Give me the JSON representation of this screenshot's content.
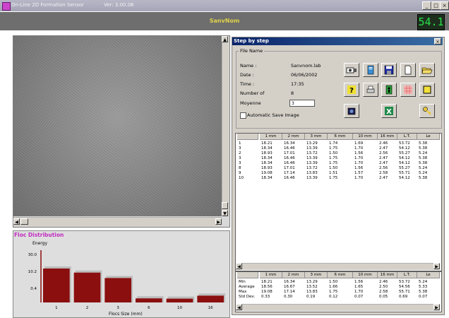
{
  "window": {
    "title": "On-Line 2D Formation Sensor",
    "version": "Ver: 3.00.06",
    "buttons": [
      "_",
      "□",
      "×"
    ]
  },
  "header": {
    "sample_name": "SanvNom",
    "readout": "54.1"
  },
  "floc_distribution": {
    "title": "Floc Distribution"
  },
  "chart_data": {
    "type": "bar",
    "title": "",
    "ylabel": "Energy",
    "xlabel": "Flocs Size (mm)",
    "categories": [
      "1",
      "2",
      "3",
      "6",
      "10",
      "16"
    ],
    "values": [
      12.5,
      11.0,
      9.0,
      1.5,
      1.4,
      2.5
    ],
    "ytick_labels": [
      "30.0",
      "10.2",
      "0.4"
    ],
    "yticks": [
      30.0,
      10.2,
      0.4
    ],
    "ylim": [
      0,
      30.0
    ],
    "bar_color": "#8b0f0f",
    "background_bar_color": "#bcbcbc",
    "grid": false
  },
  "dialog": {
    "title": "Step by step",
    "close_label": "×",
    "file_name_legend": "File Name",
    "fields": [
      {
        "label": "Name :",
        "value": "Sanvnom.lab"
      },
      {
        "label": "Date :",
        "value": "06/06/2002"
      },
      {
        "label": "Time :",
        "value": "17:35"
      },
      {
        "label": "Number of",
        "value": "8"
      },
      {
        "label": "Moyenne",
        "value": ""
      }
    ],
    "moyenne_input_value": "3",
    "auto_save_label": "Automatic Save Image",
    "toolbar_icons": [
      "camera-film-icon",
      "notepad-icon",
      "save-disk-icon",
      "new-page-icon",
      "open-folder-icon",
      "help-icon",
      "print-icon",
      "exit-door-icon",
      "color-grid-icon",
      "yellow-square-icon",
      "photo-camera-icon",
      "excel-icon",
      "key-icon"
    ]
  },
  "results_table": {
    "columns": [
      "",
      "1 mm",
      "2 mm",
      "3 mm",
      "6 mm",
      "10 mm",
      "16 mm",
      "L.T.",
      "Le"
    ],
    "rows": [
      [
        "1",
        "18.21",
        "16.34",
        "13.29",
        "1.74",
        "1.69",
        "2.46",
        "53.72",
        "5.38"
      ],
      [
        "3",
        "18.34",
        "16.46",
        "13.39",
        "1.75",
        "1.70",
        "2.47",
        "54.12",
        "5.38"
      ],
      [
        "2",
        "18.93",
        "17.01",
        "13.72",
        "1.50",
        "1.56",
        "2.56",
        "55.27",
        "5.24"
      ],
      [
        "3",
        "18.34",
        "16.46",
        "13.39",
        "1.75",
        "1.70",
        "2.47",
        "54.12",
        "5.38"
      ],
      [
        "3",
        "18.34",
        "16.46",
        "13.39",
        "1.75",
        "1.70",
        "2.47",
        "54.12",
        "5.38"
      ],
      [
        "8",
        "18.93",
        "17.01",
        "13.72",
        "1.50",
        "1.56",
        "2.56",
        "55.27",
        "5.24"
      ],
      [
        "9",
        "19.08",
        "17.14",
        "13.83",
        "1.51",
        "1.57",
        "2.58",
        "55.71",
        "5.24"
      ],
      [
        "10",
        "18.34",
        "16.46",
        "13.39",
        "1.75",
        "1.70",
        "2.47",
        "54.12",
        "5.38"
      ]
    ]
  },
  "stats_table": {
    "columns": [
      "",
      "1 mm",
      "2 mm",
      "3 mm",
      "6 mm",
      "10 mm",
      "16 mm",
      "L.T.",
      "Le"
    ],
    "rows": [
      [
        "Min",
        "18.21",
        "16.34",
        "13.29",
        "1.50",
        "1.56",
        "2.46",
        "53.72",
        "5.24"
      ],
      [
        "Average",
        "18.56",
        "16.67",
        "13.52",
        "1.66",
        "1.65",
        "2.50",
        "54.56",
        "5.33"
      ],
      [
        "Max",
        "19.08",
        "17.14",
        "13.83",
        "1.75",
        "1.70",
        "2.58",
        "55.71",
        "5.38"
      ],
      [
        "Std Dev.",
        "0.33",
        "0.30",
        "0.19",
        "0.12",
        "0.07",
        "0.05",
        "0.69",
        "0.07"
      ]
    ]
  }
}
